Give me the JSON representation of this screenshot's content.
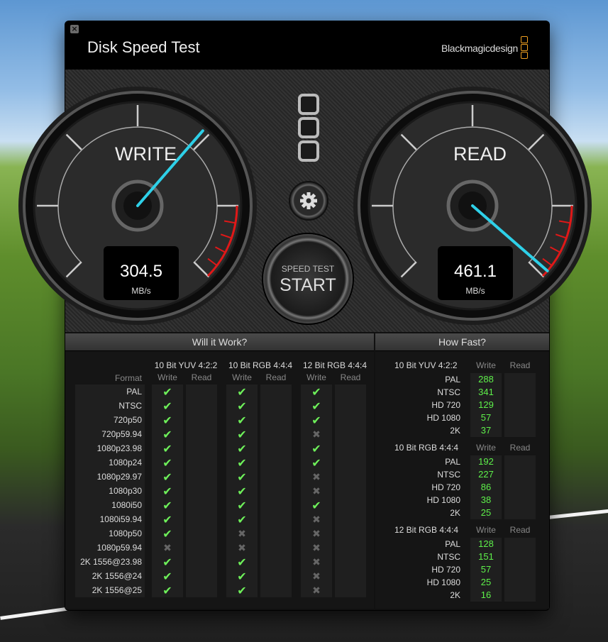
{
  "app": {
    "title": "Disk Speed Test",
    "brand": "Blackmagicdesign"
  },
  "gauges": {
    "write": {
      "label": "WRITE",
      "value": "304.5",
      "unit": "MB/s"
    },
    "read": {
      "label": "READ",
      "value": "461.1",
      "unit": "MB/s"
    }
  },
  "start_button": {
    "top": "SPEED TEST",
    "main": "START"
  },
  "will_it_work": {
    "title": "Will it Work?",
    "format_header": "Format",
    "write_label": "Write",
    "read_label": "Read",
    "groups": [
      "10 Bit YUV 4:2:2",
      "10 Bit RGB 4:4:4",
      "12 Bit RGB 4:4:4"
    ],
    "rows": [
      {
        "format": "PAL",
        "results": [
          "yes",
          "yes",
          "yes"
        ]
      },
      {
        "format": "NTSC",
        "results": [
          "yes",
          "yes",
          "yes"
        ]
      },
      {
        "format": "720p50",
        "results": [
          "yes",
          "yes",
          "yes"
        ]
      },
      {
        "format": "720p59.94",
        "results": [
          "yes",
          "yes",
          "no"
        ]
      },
      {
        "format": "1080p23.98",
        "results": [
          "yes",
          "yes",
          "yes"
        ]
      },
      {
        "format": "1080p24",
        "results": [
          "yes",
          "yes",
          "yes"
        ]
      },
      {
        "format": "1080p29.97",
        "results": [
          "yes",
          "yes",
          "no"
        ]
      },
      {
        "format": "1080p30",
        "results": [
          "yes",
          "yes",
          "no"
        ]
      },
      {
        "format": "1080i50",
        "results": [
          "yes",
          "yes",
          "yes"
        ]
      },
      {
        "format": "1080i59.94",
        "results": [
          "yes",
          "yes",
          "no"
        ]
      },
      {
        "format": "1080p50",
        "results": [
          "yes",
          "no",
          "no"
        ]
      },
      {
        "format": "1080p59.94",
        "results": [
          "no",
          "no",
          "no"
        ]
      },
      {
        "format": "2K 1556@23.98",
        "results": [
          "yes",
          "yes",
          "no"
        ]
      },
      {
        "format": "2K 1556@24",
        "results": [
          "yes",
          "yes",
          "no"
        ]
      },
      {
        "format": "2K 1556@25",
        "results": [
          "yes",
          "yes",
          "no"
        ]
      }
    ]
  },
  "how_fast": {
    "title": "How Fast?",
    "write_label": "Write",
    "read_label": "Read",
    "groups": [
      {
        "name": "10 Bit YUV 4:2:2",
        "rows": [
          {
            "format": "PAL",
            "write": "288"
          },
          {
            "format": "NTSC",
            "write": "341"
          },
          {
            "format": "HD 720",
            "write": "129"
          },
          {
            "format": "HD 1080",
            "write": "57"
          },
          {
            "format": "2K",
            "write": "37"
          }
        ]
      },
      {
        "name": "10 Bit RGB 4:4:4",
        "rows": [
          {
            "format": "PAL",
            "write": "192"
          },
          {
            "format": "NTSC",
            "write": "227"
          },
          {
            "format": "HD 720",
            "write": "86"
          },
          {
            "format": "HD 1080",
            "write": "38"
          },
          {
            "format": "2K",
            "write": "25"
          }
        ]
      },
      {
        "name": "12 Bit RGB 4:4:4",
        "rows": [
          {
            "format": "PAL",
            "write": "128"
          },
          {
            "format": "NTSC",
            "write": "151"
          },
          {
            "format": "HD 720",
            "write": "57"
          },
          {
            "format": "HD 1080",
            "write": "25"
          },
          {
            "format": "2K",
            "write": "16"
          }
        ]
      }
    ]
  }
}
